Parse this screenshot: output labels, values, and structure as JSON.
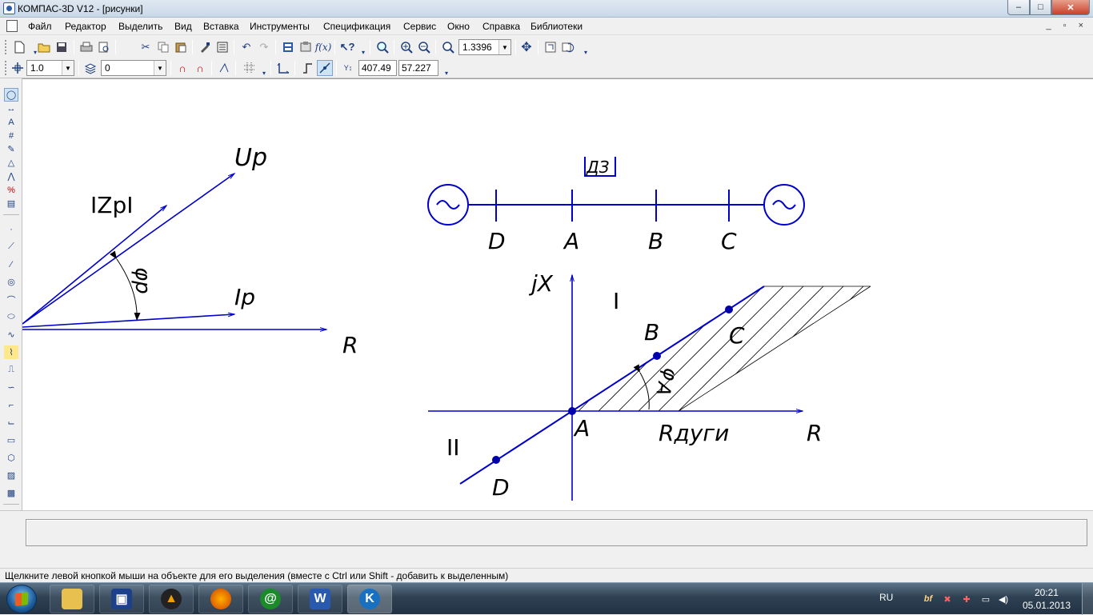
{
  "window": {
    "title": "КОМПАС-3D V12 - [рисунки]",
    "controls": {
      "minimize": "–",
      "maximize": "□",
      "close": "✕"
    }
  },
  "menu": {
    "items": [
      "Файл",
      "Редактор",
      "Выделить",
      "Вид",
      "Вставка",
      "Инструменты",
      "Спецификация",
      "Сервис",
      "Окно",
      "Справка",
      "Библиотеки"
    ],
    "mdi_controls": "_ ▫ ×"
  },
  "toolbar_standard": {
    "zoom_value": "1.3396"
  },
  "toolbar_current_state": {
    "step_value": "1.0",
    "layer_value": "0",
    "coord_x": "407.49",
    "coord_y": "57.227"
  },
  "drawing": {
    "left_figure": {
      "label_up": "Up",
      "label_izp": "IZpI",
      "label_phi": "φp",
      "label_ip": "Ip",
      "label_r": "R"
    },
    "schematic": {
      "relay_label": "ДЗ",
      "points": [
        "D",
        "A",
        "B",
        "C"
      ]
    },
    "diagram": {
      "label_jx": "jX",
      "label_quadrant_1": "I",
      "label_quadrant_2": "II",
      "label_r": "R",
      "label_rarc": "Rдуги",
      "label_phi": "φ",
      "label_angle": "A",
      "points": {
        "A": "A",
        "B": "B",
        "C": "C",
        "D": "D"
      }
    },
    "colors": {
      "line": "#0000cc",
      "hatch": "#000000",
      "background": "#ffffff"
    }
  },
  "status": {
    "message": "Щелкните левой кнопкой мыши на объекте для его выделения (вместе с Ctrl или Shift - добавить к выделенным)"
  },
  "taskbar": {
    "apps": [
      "explorer",
      "floppy-save",
      "archiver",
      "firefox",
      "mail-agent",
      "word",
      "kompas"
    ],
    "language": "RU",
    "time": "20:21",
    "date": "05.01.2013"
  }
}
